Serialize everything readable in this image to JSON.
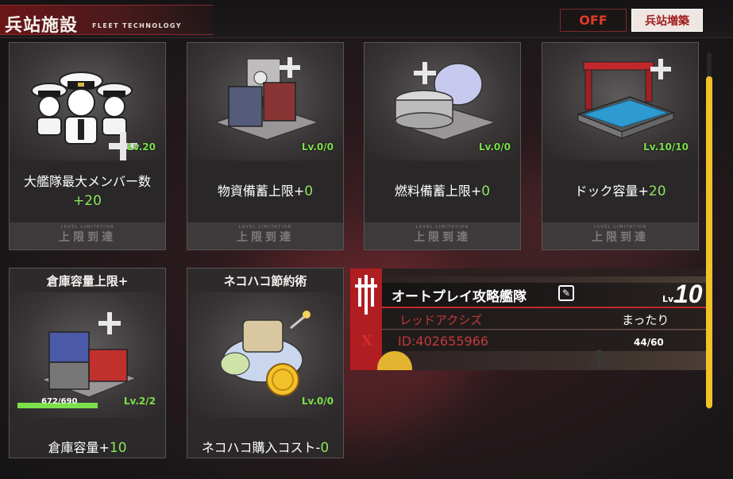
{
  "header": {
    "title": "兵站施設",
    "subtitle": "FLEET TECHNOLOGY",
    "off_label": "OFF",
    "expand_label": "兵站増築"
  },
  "cards_top": [
    {
      "level": "Lv.20",
      "desc": "大艦隊最大メンバー数",
      "value": "+20",
      "status": "上限到達",
      "status_small": "LEVEL LIMITATION"
    },
    {
      "level": "Lv.0/0",
      "desc": "物資備蓄上限+",
      "value": "0",
      "status": "上限到達",
      "status_small": "LEVEL LIMITATION"
    },
    {
      "level": "Lv.0/0",
      "desc": "燃料備蓄上限+",
      "value": "0",
      "status": "上限到達",
      "status_small": "LEVEL LIMITATION"
    },
    {
      "level": "Lv.10/10",
      "desc": "ドック容量+",
      "value": "20",
      "status": "上限到達",
      "status_small": "LEVEL LIMITATION"
    }
  ],
  "cards_bottom": [
    {
      "title": "倉庫容量上限+",
      "level": "Lv.2/2",
      "desc": "倉庫容量+",
      "value": "10",
      "capacity": "672/690",
      "capacity_fraction": 0.974
    },
    {
      "title": "ネコハコ節約術",
      "level": "Lv.0/0",
      "desc": "ネコハコ購入コスト-",
      "value": "0"
    }
  ],
  "fleet": {
    "name": "オートプレイ攻略艦隊",
    "level_label": "Lv.",
    "level": "10",
    "subname": "レッドアクシズ",
    "style": "まったり",
    "x_mark": "X",
    "id": "ID:402655966",
    "members": "44/60"
  },
  "colors": {
    "accent_red": "#b01e22",
    "level_green": "#7be04a",
    "scrollbar": "#f0c22a"
  }
}
